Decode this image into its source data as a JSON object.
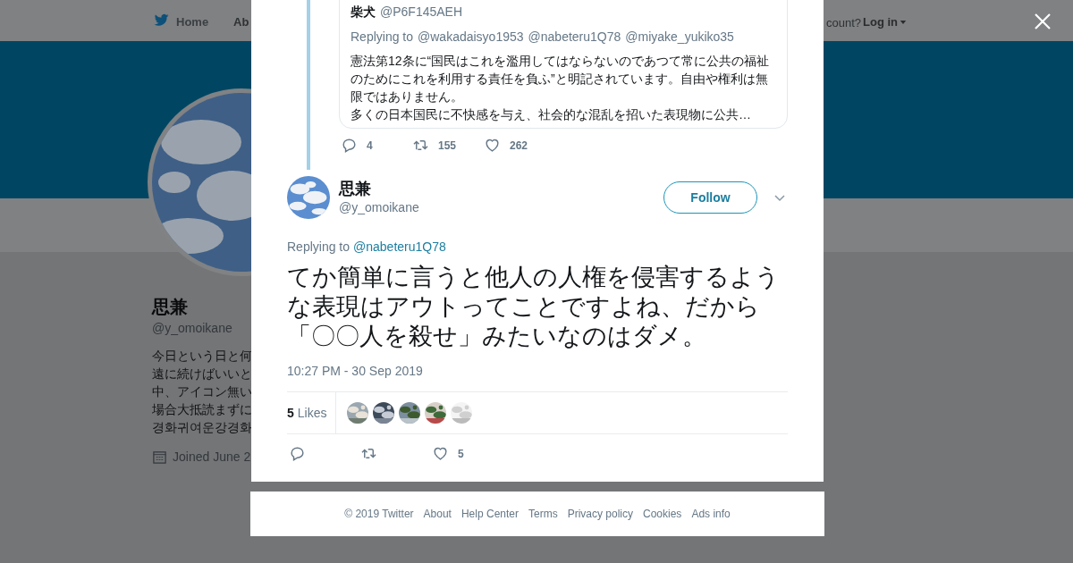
{
  "background_page": {
    "nav": {
      "home": "Home",
      "about": "Ab",
      "account_prompt": "count?",
      "login": "Log in"
    },
    "profile": {
      "name": "思兼",
      "handle": "@y_omoikane",
      "bio_lines": [
        "今日という日と何",
        "遠に続けばいいと",
        "中、アイコン無い",
        "場合大抵読まずに",
        "경화귀여운강경화"
      ],
      "joined": "Joined June 2"
    }
  },
  "modal": {
    "parent_tweet": {
      "quoted": {
        "name": "柴犬",
        "handle": "@P6F145AEH",
        "replying_label": "Replying to",
        "replying_to": [
          "@wakadaisyo1953",
          "@nabeteru1Q78",
          "@miyake_yukiko35"
        ],
        "paragraphs": [
          "憲法第12条に“国民はこれを濫用してはならないのであつて常に公共の福祉のためにこれを利用する責任を負ふ”と明記されています。自由や権利は無限ではありません。",
          "多くの日本国民に不快感を与え、社会的な混乱を招いた表現物に公共…"
        ]
      },
      "actions": [
        {
          "kind": "reply",
          "count": "4"
        },
        {
          "kind": "retweet",
          "count": "155"
        },
        {
          "kind": "like",
          "count": "262"
        }
      ]
    },
    "tweet": {
      "name": "思兼",
      "handle": "@y_omoikane",
      "follow_button": "Follow",
      "replying_label": "Replying to",
      "replying_to": "@nabeteru1Q78",
      "text": "てか簡単に言うと他人の人権を侵害するような表現はアウトってことですよね、だから「〇〇人を殺せ」みたいなのはダメ。",
      "timestamp": "10:27 PM - 30 Sep 2019",
      "likes_count": "5",
      "likes_label": "Likes",
      "actions": [
        {
          "kind": "reply"
        },
        {
          "kind": "retweet"
        },
        {
          "kind": "like",
          "count": "5"
        }
      ]
    }
  },
  "footer": {
    "links": [
      "© 2019 Twitter",
      "About",
      "Help Center",
      "Terms",
      "Privacy policy",
      "Cookies",
      "Ads info"
    ]
  }
}
